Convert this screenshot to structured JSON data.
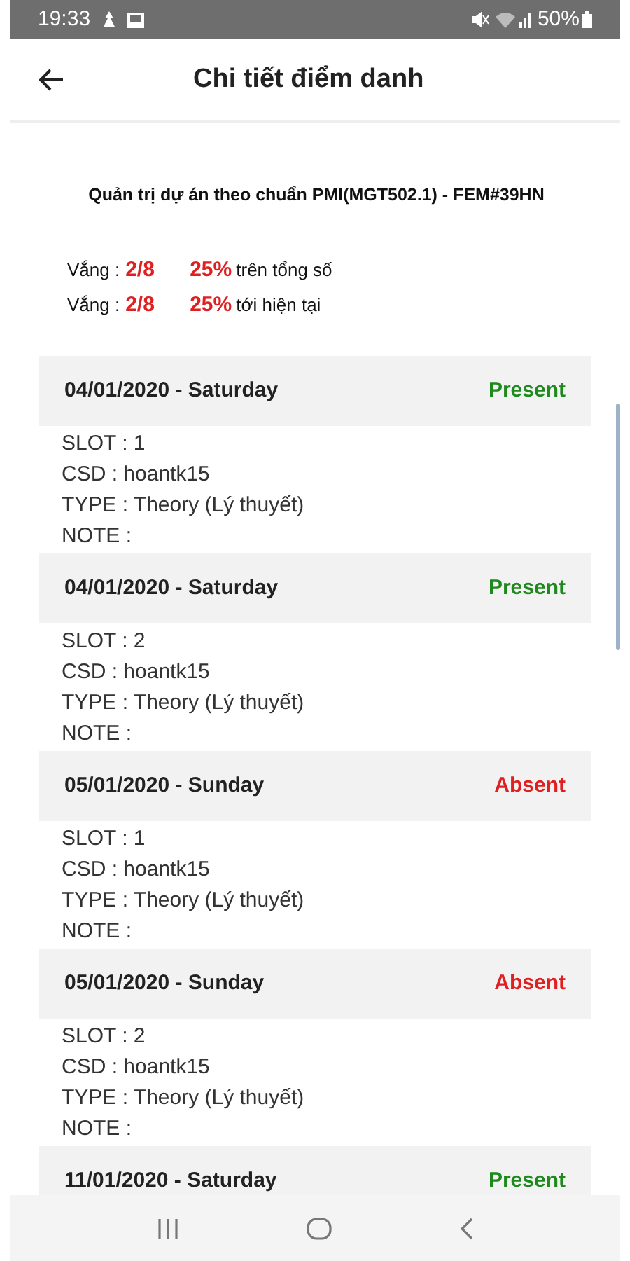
{
  "status_bar": {
    "time": "19:33",
    "battery": "50%"
  },
  "header": {
    "title": "Chi tiết điểm danh"
  },
  "course": "Quản trị dự án theo chuẩn PMI(MGT502.1) - FEM#39HN",
  "summary": [
    {
      "label": "Vắng :",
      "count": "2/8",
      "percent": "25%",
      "suffix": "trên tổng số"
    },
    {
      "label": "Vắng :",
      "count": "2/8",
      "percent": "25%",
      "suffix": "tới hiện tại"
    }
  ],
  "sessions": [
    {
      "date": "04/01/2020 - Saturday",
      "status": "Present",
      "present": true,
      "lines": [
        "SLOT : 1",
        "CSD : hoantk15",
        "TYPE : Theory (Lý thuyết)",
        "NOTE :"
      ]
    },
    {
      "date": "04/01/2020 - Saturday",
      "status": "Present",
      "present": true,
      "lines": [
        "SLOT : 2",
        "CSD : hoantk15",
        "TYPE : Theory (Lý thuyết)",
        "NOTE :"
      ]
    },
    {
      "date": "05/01/2020 - Sunday",
      "status": "Absent",
      "present": false,
      "lines": [
        "SLOT : 1",
        "CSD : hoantk15",
        "TYPE : Theory (Lý thuyết)",
        "NOTE :"
      ]
    },
    {
      "date": "05/01/2020 - Sunday",
      "status": "Absent",
      "present": false,
      "lines": [
        "SLOT : 2",
        "CSD : hoantk15",
        "TYPE : Theory (Lý thuyết)",
        "NOTE :"
      ]
    },
    {
      "date": "11/01/2020 - Saturday",
      "status": "Present",
      "present": true
    }
  ]
}
